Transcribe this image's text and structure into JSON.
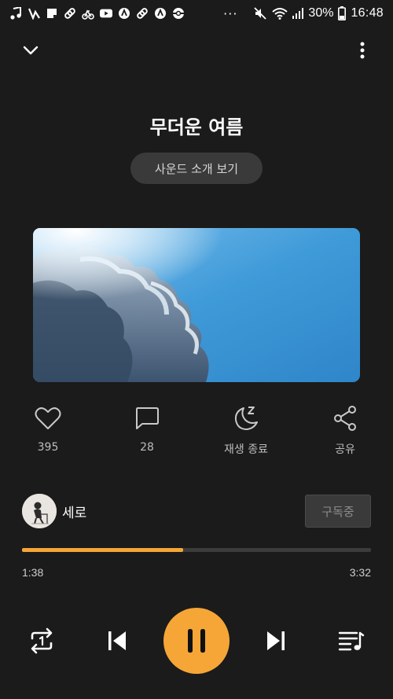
{
  "status_bar": {
    "icons": [
      "music-note-icon",
      "notification-icon",
      "note-icon",
      "link-icon",
      "bike-icon",
      "youtube-icon",
      "app-icon",
      "link-icon",
      "app-icon",
      "pokeball-icon",
      "more-icon",
      "mute-icon",
      "wifi-icon",
      "signal-icon",
      "battery-icon"
    ],
    "dots": "···",
    "battery": "30%",
    "time": "16:48"
  },
  "header": {
    "collapse_icon": "chevron-down-icon",
    "menu_icon": "more-vert-icon"
  },
  "track": {
    "title": "무더운 여름",
    "intro_label": "사운드 소개 보기"
  },
  "actions": [
    {
      "icon": "heart-icon",
      "label": "395"
    },
    {
      "icon": "comment-icon",
      "label": "28"
    },
    {
      "icon": "sleep-timer-icon",
      "label": "재생 종료"
    },
    {
      "icon": "share-icon",
      "label": "공유"
    }
  ],
  "artist": {
    "name": "세로",
    "subscribe_label": "구독중"
  },
  "progress": {
    "current": "1:38",
    "total": "3:32",
    "fraction": 0.462
  },
  "controls": {
    "repeat_icon": "repeat-one-icon",
    "prev_icon": "skip-previous-icon",
    "play_state_icon": "pause-icon",
    "next_icon": "skip-next-icon",
    "playlist_icon": "playlist-icon"
  },
  "colors": {
    "accent": "#f5a637",
    "background": "#1b1b1b"
  }
}
